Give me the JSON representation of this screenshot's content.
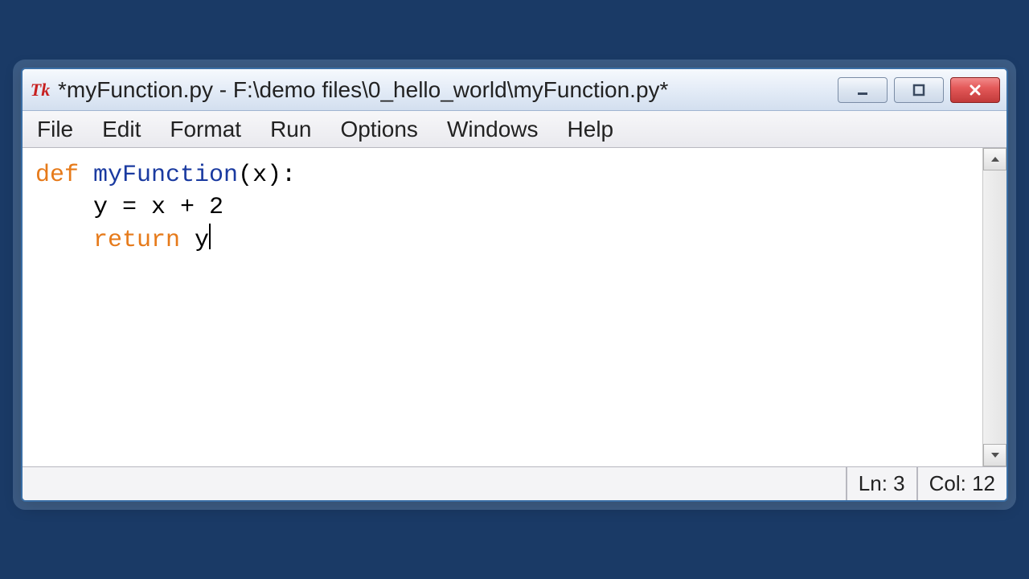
{
  "window": {
    "title": "*myFunction.py - F:\\demo files\\0_hello_world\\myFunction.py*"
  },
  "menu": {
    "items": [
      "File",
      "Edit",
      "Format",
      "Run",
      "Options",
      "Windows",
      "Help"
    ]
  },
  "code": {
    "line1_kw": "def",
    "line1_fn": " myFunction",
    "line1_rest": "(x):",
    "line2": "    y = x + 2",
    "line3_kw": "    return",
    "line3_rest": " y"
  },
  "status": {
    "line_label": "Ln: 3",
    "col_label": "Col: 12"
  }
}
